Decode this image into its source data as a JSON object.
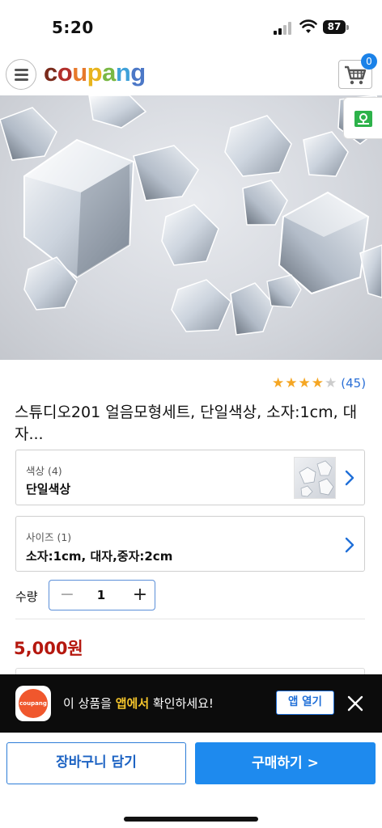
{
  "status_bar": {
    "time": "5:20",
    "battery": "87"
  },
  "header": {
    "logo_letters": [
      "c",
      "o",
      "u",
      "p",
      "a",
      "n",
      "g"
    ],
    "cart_count": "0",
    "icons": [
      "menu-icon",
      "cart-icon"
    ]
  },
  "hero": {
    "icons": [
      "map-pin-icon"
    ]
  },
  "product": {
    "rating": {
      "value": 4,
      "max": 5,
      "count": "(45)",
      "star_color": "#f5a623",
      "empty_star_color": "#cccccc"
    },
    "title": "스튜디오201 얼음모형세트, 단일색상, 소자:1cm, 대자...",
    "options": [
      {
        "label": "색상 (4)",
        "value": "단일색상"
      },
      {
        "label": "사이즈 (1)",
        "value": "소자:1cm, 대자,중자:2cm"
      }
    ],
    "quantity": {
      "label": "수량",
      "minus": "−",
      "value": "1",
      "plus": "+"
    },
    "price": "5,000원"
  },
  "app_banner": {
    "app_icon_text": "coupang",
    "message_pre": "이 상품을 ",
    "message_highlight": "앱에서",
    "message_post": " 확인하세요!",
    "open_button": "앱 열기",
    "highlight_color": "#f7c72c"
  },
  "actions": {
    "add_to_cart": "장바구니 담기",
    "buy_now": "구매하기 >"
  },
  "colors": {
    "accent_blue": "#1e8aee",
    "price_red": "#b5180f",
    "link_blue": "#2a6fd6"
  }
}
